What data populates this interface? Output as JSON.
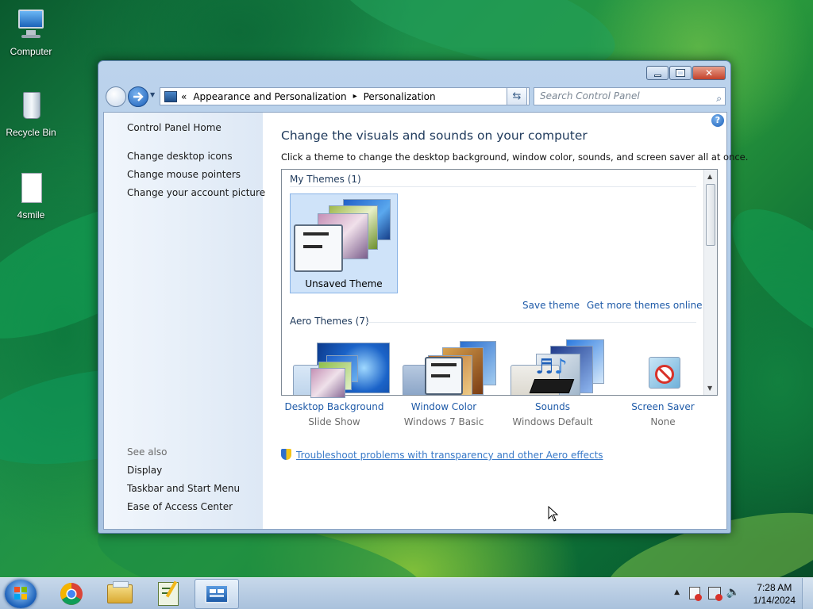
{
  "desktop": {
    "icons": [
      {
        "label": "Computer"
      },
      {
        "label": "Recycle Bin"
      },
      {
        "label": "4smile"
      }
    ]
  },
  "window": {
    "address": {
      "overflow": "«",
      "crumb1": "Appearance and Personalization",
      "sep": "▸",
      "crumb2": "Personalization"
    },
    "search_placeholder": "Search Control Panel",
    "left_pane": {
      "home": "Control Panel Home",
      "links": [
        "Change desktop icons",
        "Change mouse pointers",
        "Change your account picture"
      ],
      "see_also_title": "See also",
      "see_also": [
        "Display",
        "Taskbar and Start Menu",
        "Ease of Access Center"
      ]
    },
    "heading": "Change the visuals and sounds on your computer",
    "description": "Click a theme to change the desktop background, window color, sounds, and screen saver all at once.",
    "my_themes_label": "My Themes (1)",
    "unsaved_theme_label": "Unsaved Theme",
    "save_theme_link": "Save theme",
    "get_more_link": "Get more themes online",
    "aero_themes_label": "Aero Themes (7)",
    "bottom": [
      {
        "title": "Desktop Background",
        "subtitle": "Slide Show"
      },
      {
        "title": "Window Color",
        "subtitle": "Windows 7 Basic"
      },
      {
        "title": "Sounds",
        "subtitle": "Windows Default"
      },
      {
        "title": "Screen Saver",
        "subtitle": "None"
      }
    ],
    "troubleshoot_link": "Troubleshoot problems with transparency and other Aero effects"
  },
  "taskbar": {
    "time": "7:28 AM",
    "date": "1/14/2024"
  },
  "colors": {
    "link": "#1e5aa8",
    "heading": "#1e395b",
    "selected_tile": "#cfe3f9"
  }
}
